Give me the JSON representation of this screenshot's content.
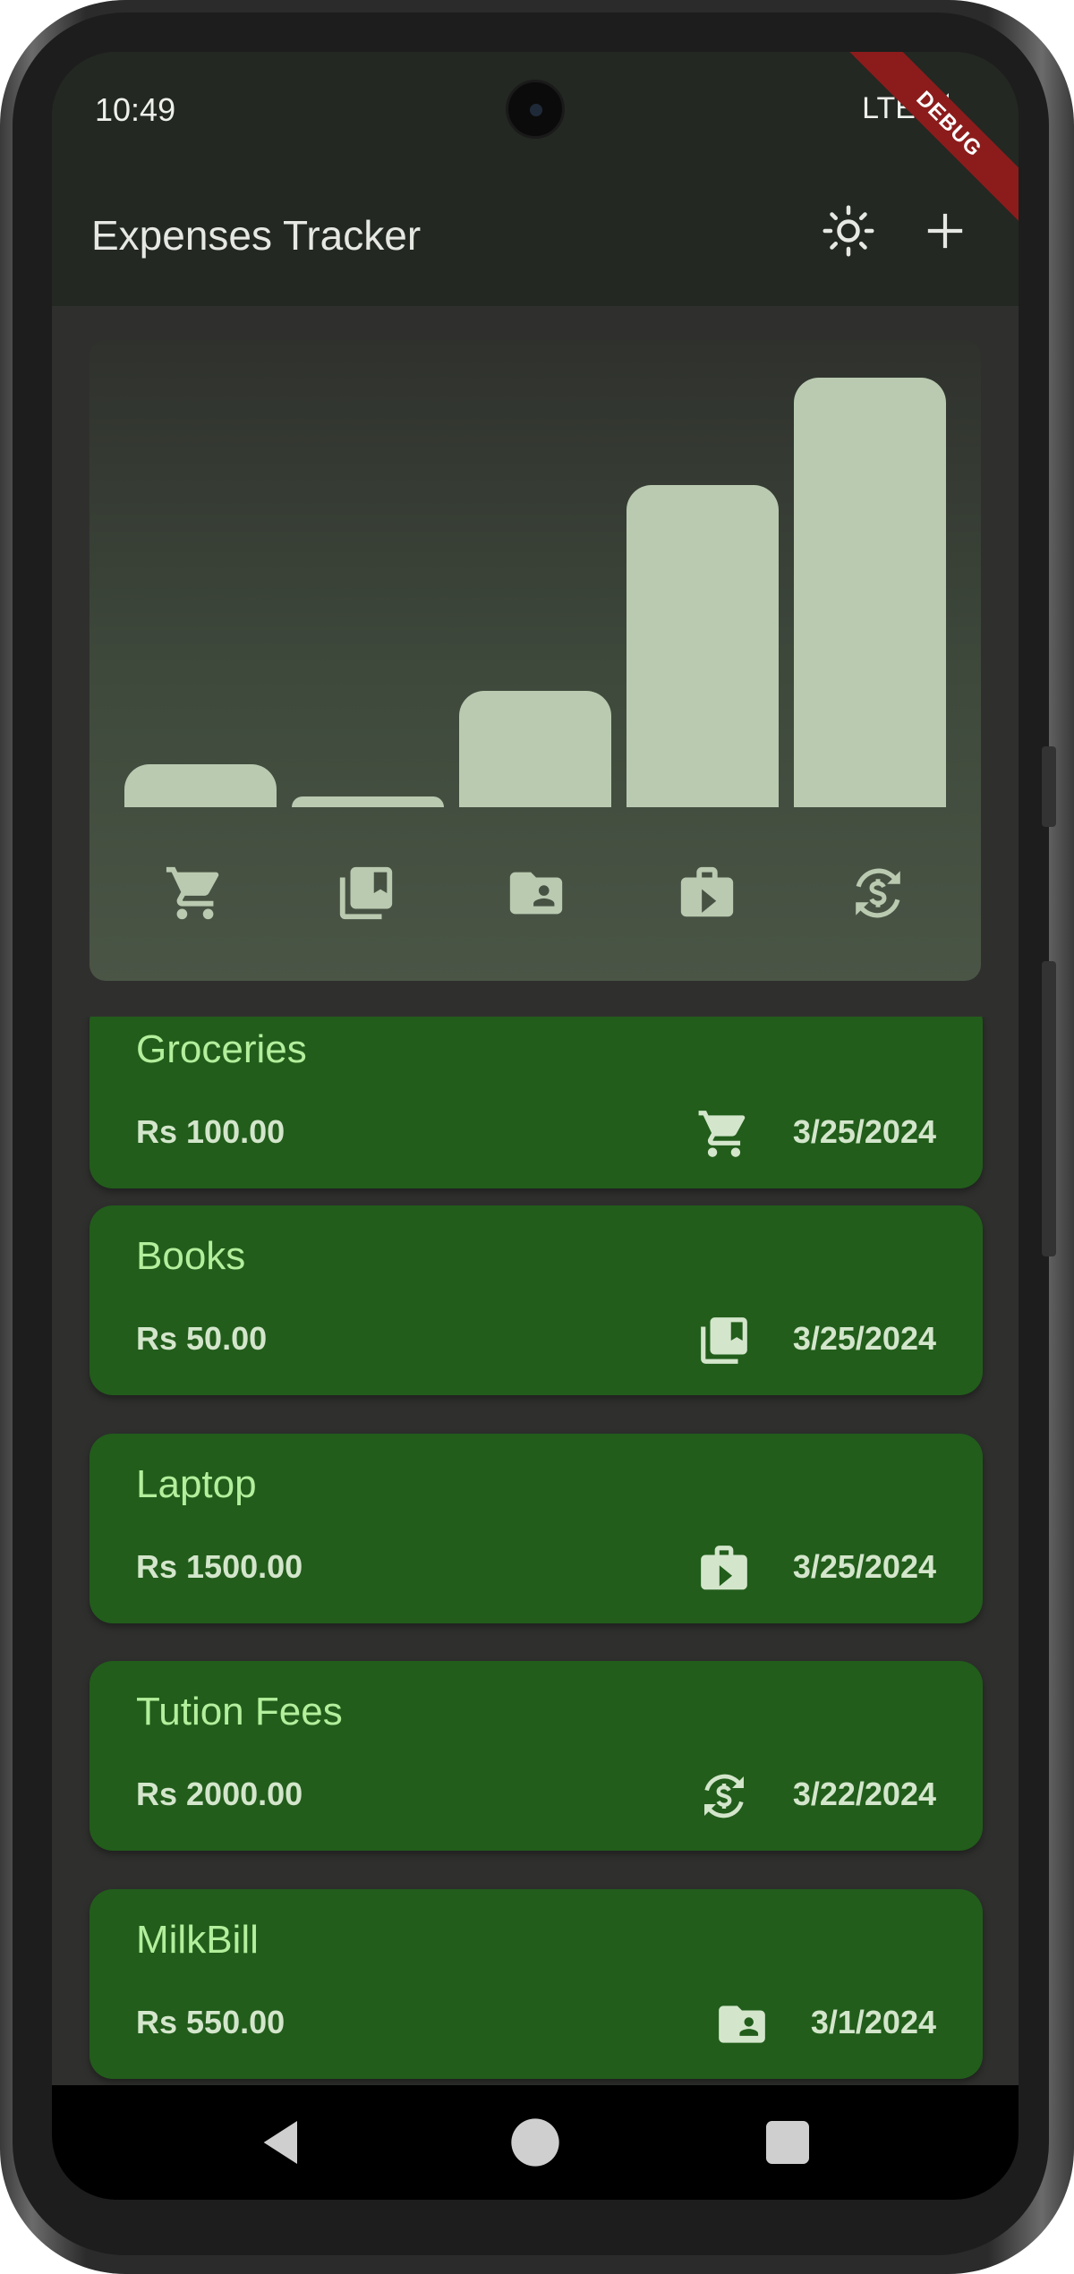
{
  "status_bar": {
    "time": "10:49",
    "network": "LTE"
  },
  "debug_banner": "DEBUG",
  "app_bar": {
    "title": "Expenses Tracker",
    "theme_icon": "brightness-icon",
    "add_icon": "add-icon"
  },
  "chart_data": {
    "type": "bar",
    "categories": [
      "food",
      "leisure",
      "work",
      "travel",
      "finance"
    ],
    "category_icons": [
      "shopping-cart-icon",
      "library-books-icon",
      "folder-shared-icon",
      "work-icon",
      "currency-exchange-icon"
    ],
    "values": [
      0.1,
      0.025,
      0.27,
      0.75,
      1.0
    ],
    "ylim": [
      0,
      1
    ],
    "grid": false,
    "bar_color": "#b9cab0"
  },
  "expenses": [
    {
      "title": "Groceries",
      "amount": "Rs 100.00",
      "icon": "shopping-cart-icon",
      "date": "3/25/2024"
    },
    {
      "title": "Books",
      "amount": "Rs 50.00",
      "icon": "library-books-icon",
      "date": "3/25/2024"
    },
    {
      "title": "Laptop",
      "amount": "Rs 1500.00",
      "icon": "work-icon",
      "date": "3/25/2024"
    },
    {
      "title": "Tution Fees",
      "amount": "Rs 2000.00",
      "icon": "currency-exchange-icon",
      "date": "3/22/2024"
    },
    {
      "title": "MilkBill",
      "amount": "Rs 550.00",
      "icon": "folder-shared-icon",
      "date": "3/1/2024"
    }
  ],
  "colors": {
    "card": "#225d1b",
    "card_title": "#b3ef9c",
    "card_text": "#d3e6cb",
    "background": "#2f302e",
    "app_bar": "#232822"
  }
}
